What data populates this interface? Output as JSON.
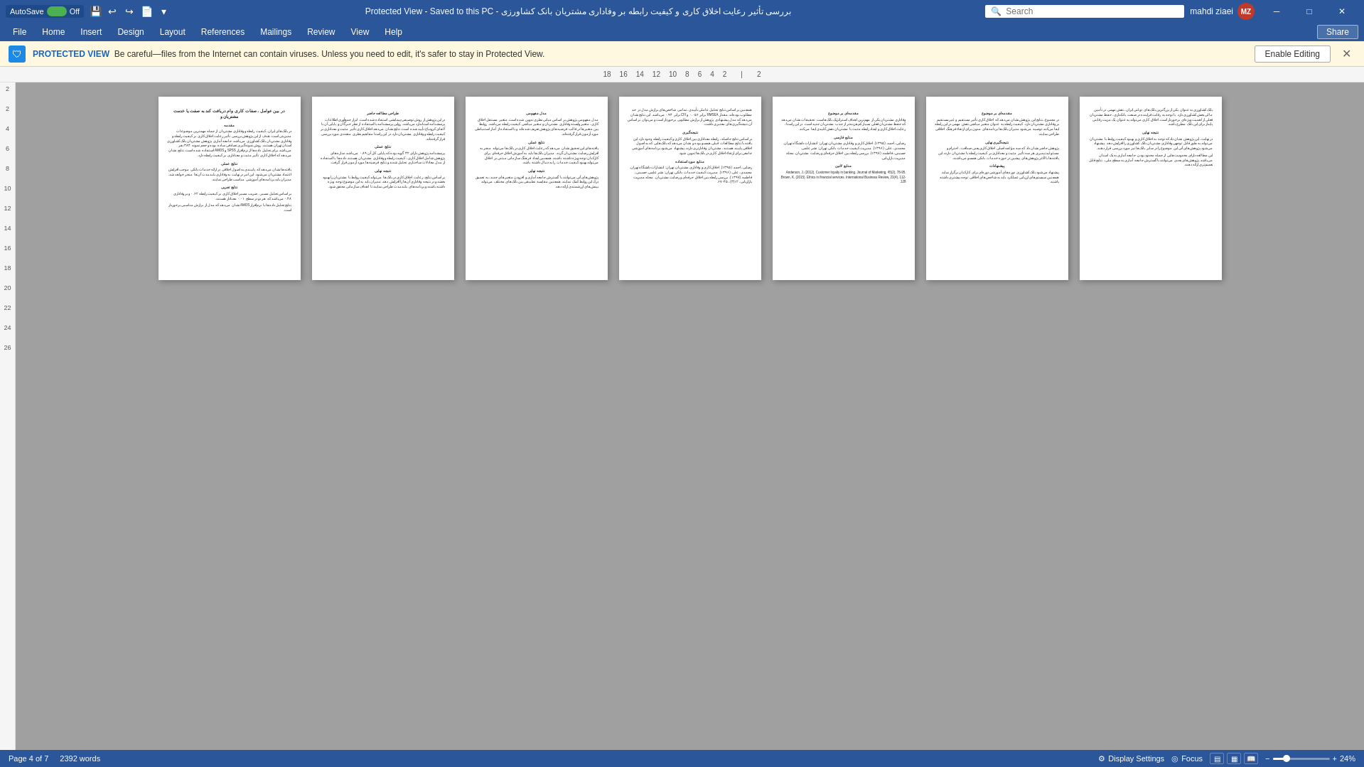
{
  "titlebar": {
    "autosave_label": "AutoSave",
    "autosave_state": "Off",
    "title": "بررسی تأثیر رعایت اخلاق کاری و کیفیت رابطه بر وفاداری مشتریان بانک کشاورزی  -  Protected View  -  Saved to this PC",
    "search_placeholder": "Search",
    "user_name": "mahdi ziaei",
    "user_initials": "MZ"
  },
  "menubar": {
    "items": [
      {
        "label": "File",
        "active": false
      },
      {
        "label": "Home",
        "active": false
      },
      {
        "label": "Insert",
        "active": false
      },
      {
        "label": "Design",
        "active": false
      },
      {
        "label": "Layout",
        "active": false
      },
      {
        "label": "References",
        "active": false
      },
      {
        "label": "Mailings",
        "active": false
      },
      {
        "label": "Review",
        "active": false
      },
      {
        "label": "View",
        "active": false
      },
      {
        "label": "Help",
        "active": false
      }
    ],
    "share_label": "Share"
  },
  "protected_view": {
    "label": "PROTECTED VIEW",
    "message": "Be careful—files from the Internet can contain viruses. Unless you need to edit, it's safer to stay in Protected View.",
    "enable_editing_label": "Enable Editing"
  },
  "ruler": {
    "numbers": [
      "18",
      "16",
      "14",
      "12",
      "10",
      "8",
      "6",
      "4",
      "2",
      "",
      "2"
    ]
  },
  "left_ruler": {
    "numbers": [
      "2",
      "2",
      "4",
      "6",
      "8",
      "10",
      "12",
      "14",
      "16",
      "18",
      "20",
      "22",
      "24",
      "26"
    ]
  },
  "pages": [
    {
      "id": 1,
      "title": "در بین عوامل ، صفات کاری وام دریافت کند به صفت یا خدمت مشتریان و",
      "subtitle": "مقدمه",
      "content": "در بانک‌های ایران، کیفیت رابطه و وفاداری مشتریان از جمله مهمترین موضوعات مدیریتی است. هدف از این پژوهش بررسی تأثیر رعایت اخلاق کاری بر کیفیت رابطه و وفاداری مشتریان بانک کشاورزی می‌باشد. جامعه آماری پژوهش مشتریان بانک کشاورزی استان تهران هستند. روش نمونه‌گیری تصادفی ساده بوده و حجم نمونه ۳۸۴ نفر می‌باشد. برای تحلیل داده‌ها از نرم‌افزار SPSS و AMOS استفاده شده است."
    },
    {
      "id": 2,
      "title": "",
      "subtitle": "طراحی مطالعه حاضر",
      "content": "در این پژوهش از روش توصیفی-پیمایشی استفاده شده است. ابزار جمع‌آوری اطلاعات پرسشنامه استاندارد می‌باشد. روایی پرسشنامه با استفاده از نظر خبرگان و پایایی آن با آلفای کرونباخ تأیید شده است. نتایج نشان می‌دهد اخلاق کاری تأثیر مثبت و معناداری بر کیفیت رابطه و وفاداری مشتریان دارد."
    },
    {
      "id": 3,
      "title": "",
      "subtitle": "نتایج عملی",
      "content": "یافته‌های این تحقیق نشان می‌دهد که رعایت اخلاق کاری در بانک‌ها می‌تواند منجر به افزایش رضایت مشتریان، تقویت اعتماد و در نهایت وفاداری آنان گردد. مدیران بانک‌ها باید به آموزش اخلاق حرفه‌ای برای کارکنان توجه ویژه داشته باشند. همچنین ایجاد فرهنگ سازمانی مبتنی بر اخلاق می‌تواند بهبود کیفیت خدمات را به دنبال داشته باشد."
    },
    {
      "id": 4,
      "title": "",
      "subtitle": "بحث و نتیجه‌گیری",
      "content": "بر اساس نتایج حاصله، رابطه معناداری بین اخلاق کاری و کیفیت رابطه وجود دارد. این یافته با نتایج مطالعات قبلی همسو بوده و نشان می‌دهد که بانک‌هایی که به اصول اخلاقی پایبند هستند، مشتریان وفادارتری دارند. پیشنهاد می‌شود برنامه‌های آموزشی جامعی برای ارتقاء اخلاق کاری در بانک‌ها تدوین شود."
    },
    {
      "id": 5,
      "title": "",
      "subtitle": "منابع فارسی",
      "content": "رضایی، احمد. (۱۳۹۵). اخلاق کاری و وفاداری مشتریان. تهران: انتشارات دانشگاه تهران. محمدی، علی. (۱۳۹۶). مدیریت کیفیت خدمات بانکی. تهران: نشر علمی. حسینی، فاطمه. (۱۳۹۷). بررسی رابطه بین اخلاق حرفه‌ای و رضایت مشتریان. مجله مدیریت بازاریابی."
    },
    {
      "id": 6,
      "title": "",
      "subtitle": "مقدمه‌ای بر موضوع",
      "content": "وفاداری مشتریان یکی از مهم‌ترین اهداف استراتژیک بانک‌هاست. تحقیقات نشان می‌دهد که حفظ مشتریان فعلی بسیار کم‌هزینه‌تر از جذب مشتریان جدید است. در این راستا، رعایت اخلاق کاری و ایجاد رابطه مثبت با مشتریان نقش کلیدی ایفا می‌کند. بانک کشاورزی به عنوان یکی از بزرگترین بانک‌های کشور در این زمینه مطالعه شده است."
    },
    {
      "id": 7,
      "title": "",
      "subtitle": "نتیجه‌گیری کلی",
      "content": "در مجموع، نتایج این پژوهش نشان می‌دهد که اخلاق کاری تأثیر مستقیم و غیرمستقیم بر وفاداری مشتریان دارد. کیفیت رابطه به عنوان متغیر میانجی نقش مهمی در این رابطه ایفا می‌کند. توصیه می‌شود مدیران بانک‌ها برنامه‌های مدون و سیستماتیک برای ارتقاء فرهنگ اخلاقی در سازمان طراحی نمایند تا رضایت و وفاداری مشتریان افزایش یابد."
    }
  ],
  "statusbar": {
    "page_info": "Page 4 of 7",
    "word_count": "2392 words",
    "display_settings": "Display Settings",
    "focus": "Focus",
    "zoom_percent": "24%",
    "view_icons": [
      "print",
      "web",
      "read"
    ]
  }
}
